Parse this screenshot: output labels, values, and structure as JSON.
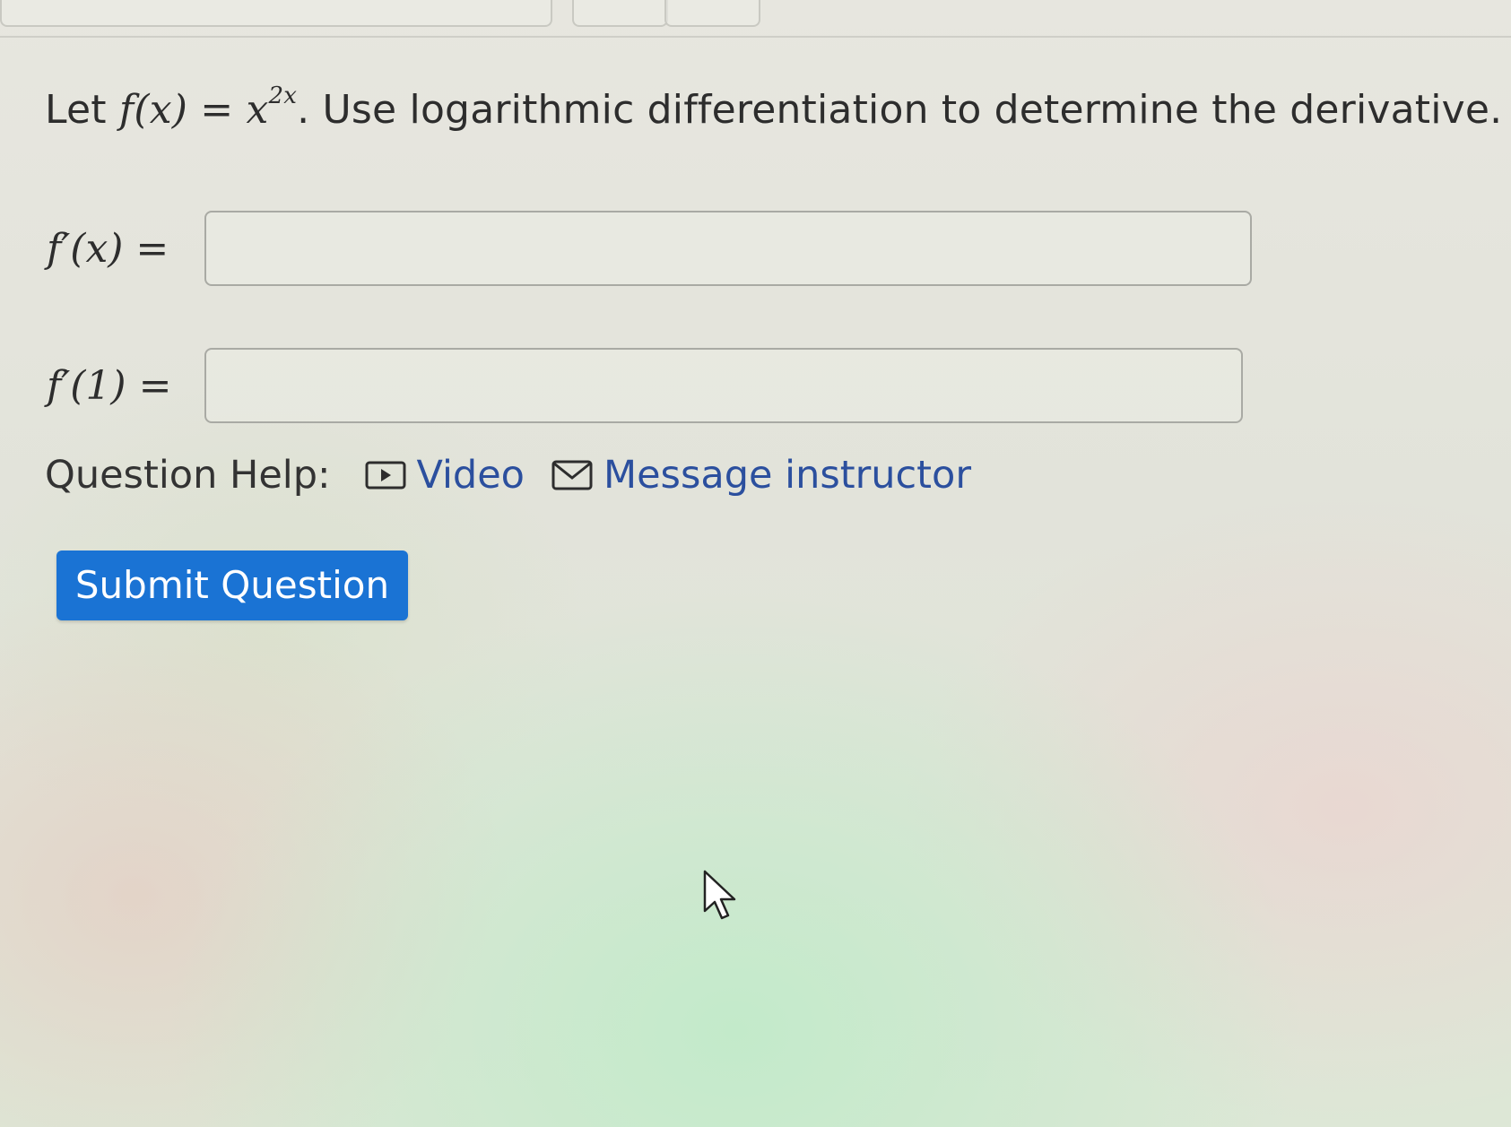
{
  "question": {
    "prefix": "Let",
    "function_lhs": "f(x) = x",
    "exponent": "2x",
    "suffix": ". Use logarithmic differentiation to determine the derivative."
  },
  "answers": [
    {
      "label": "f′(x) =",
      "value": "",
      "placeholder": ""
    },
    {
      "label": "f′(1) =",
      "value": "",
      "placeholder": ""
    }
  ],
  "help": {
    "label": "Question Help:",
    "video_label": "Video",
    "message_label": "Message instructor",
    "video_icon": "video-play-icon",
    "message_icon": "envelope-icon",
    "link_color": "#2b4f9e"
  },
  "submit": {
    "label": "Submit Question",
    "color": "#1a73d4"
  },
  "cursor_icon": "mouse-pointer-icon"
}
